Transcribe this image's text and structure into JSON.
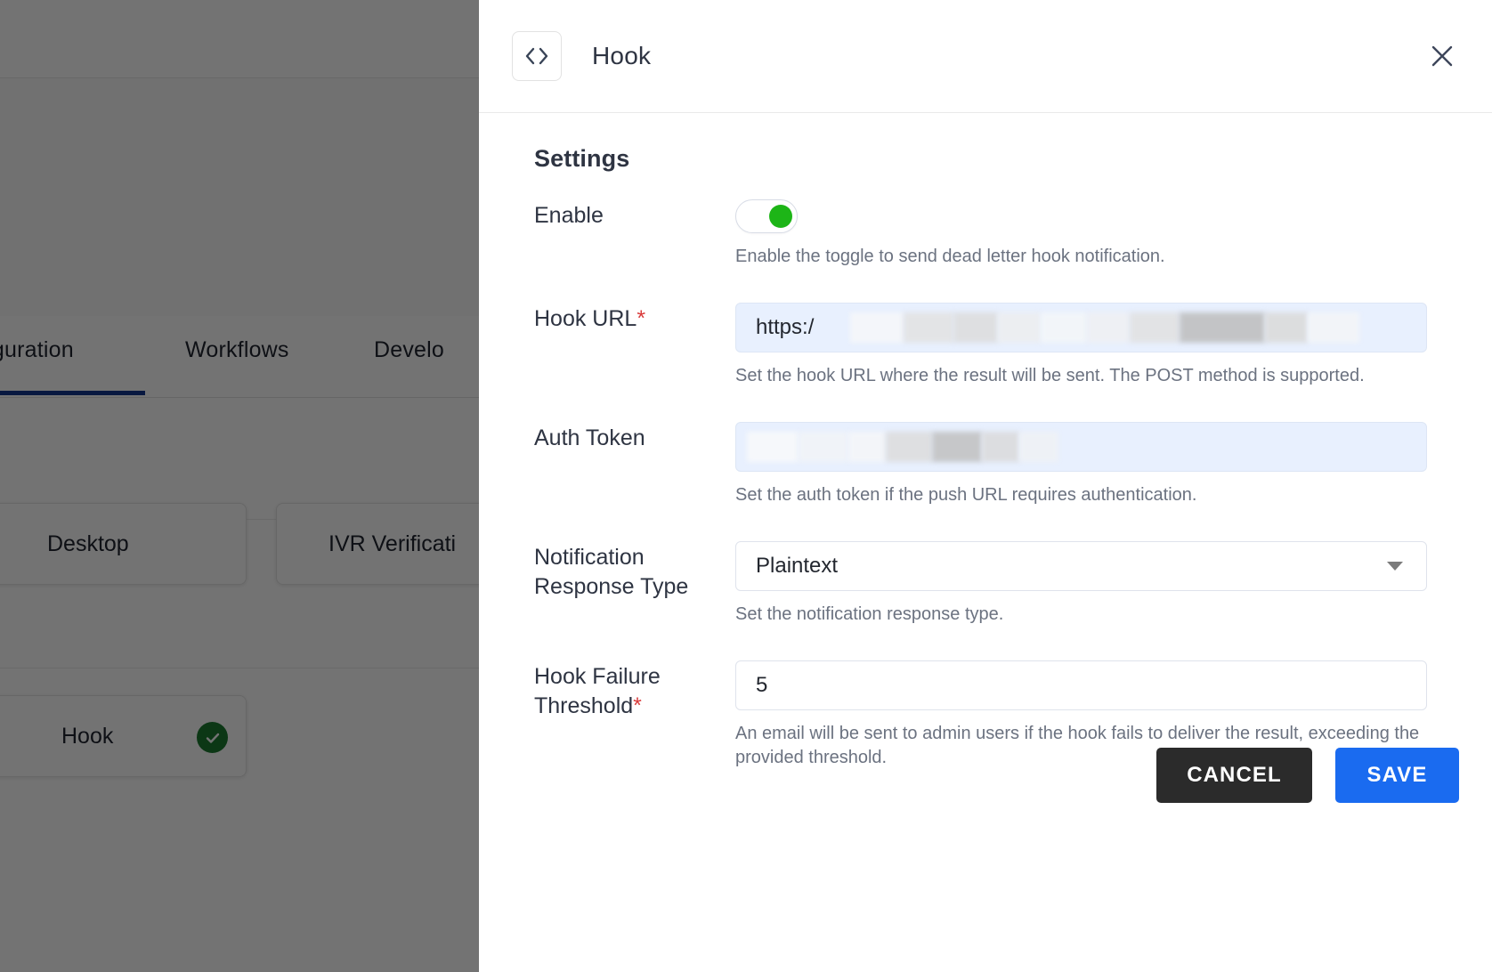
{
  "background": {
    "tabs": [
      {
        "label": "figuration",
        "active": true
      },
      {
        "label": "Workflows",
        "active": false
      },
      {
        "label": "Develo",
        "active": false
      }
    ],
    "cards": [
      {
        "label": "Desktop",
        "status": null
      },
      {
        "label": "IVR Verificati",
        "status": null
      },
      {
        "label": "Hook",
        "status": "enabled-check"
      }
    ]
  },
  "panel": {
    "icon": "code-brackets-icon",
    "title": "Hook",
    "close_icon": "close-icon",
    "settings_heading": "Settings",
    "fields": {
      "enable": {
        "label": "Enable",
        "toggle_state": "on",
        "hint": "Enable the toggle to send dead letter hook notification."
      },
      "hook_url": {
        "label": "Hook URL",
        "required": true,
        "required_marker": "*",
        "value": "https:/",
        "redacted": true,
        "hint": "Set the hook URL where the result will be sent. The POST method is supported."
      },
      "auth_token": {
        "label": "Auth Token",
        "required": false,
        "value": "",
        "redacted": true,
        "hint": "Set the auth token if the push URL requires authentication."
      },
      "notification_response_type": {
        "label": "Notification Response Type",
        "value": "Plaintext",
        "options": [
          "Plaintext"
        ],
        "hint": "Set the notification response type.",
        "arrow_icon": "chevron-down-icon"
      },
      "hook_failure_threshold": {
        "label": "Hook Failure Threshold",
        "required": true,
        "required_marker": "*",
        "value": "5",
        "hint": "An email will be sent to admin users if the hook fails to deliver the result, exceeding the provided threshold."
      }
    },
    "actions": {
      "cancel_label": "CANCEL",
      "save_label": "SAVE"
    }
  },
  "colors": {
    "accent_blue": "#1a6bf0",
    "cancel_dark": "#2b2b2b",
    "toggle_green": "#1db517",
    "required_red": "#d93b3b",
    "autofill_blue": "#e8f0fe",
    "tab_underline": "#12358f",
    "check_green": "#1b7a30"
  }
}
